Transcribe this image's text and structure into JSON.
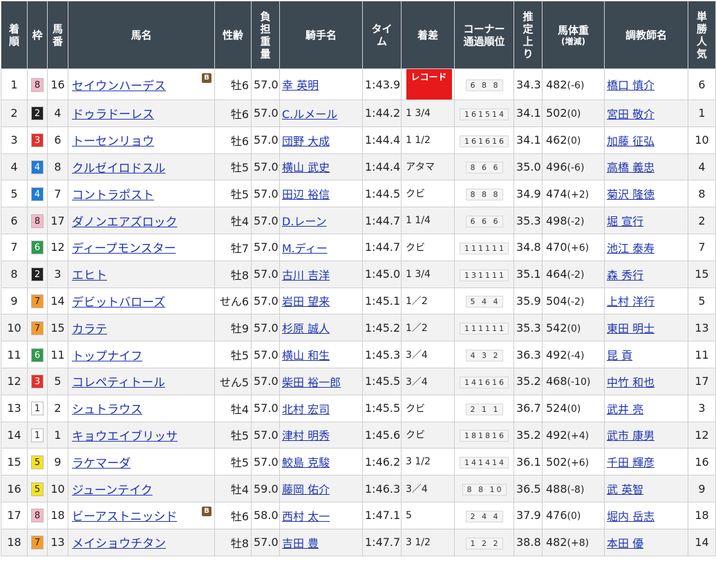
{
  "header": {
    "rank": [
      "着",
      "順"
    ],
    "waku": [
      "枠"
    ],
    "num": [
      "馬",
      "番"
    ],
    "horse": "馬名",
    "sexage": "性齢",
    "load": [
      "負",
      "担",
      "重",
      "量"
    ],
    "jockey": "騎手名",
    "time": [
      "タイ",
      "ム"
    ],
    "margin": "着差",
    "corner": [
      "コーナー",
      "通過順位"
    ],
    "last": [
      "推",
      "定",
      "上",
      "り"
    ],
    "weight_main": "馬体重",
    "weight_sub": "(増減)",
    "trainer": "調教師名",
    "pop": [
      "単",
      "勝",
      "人",
      "気"
    ]
  },
  "waku_colors": {
    "1": {
      "bg": "#ffffff",
      "fg": "#222222"
    },
    "2": {
      "bg": "#222222",
      "fg": "#ffffff"
    },
    "3": {
      "bg": "#e3312d",
      "fg": "#ffffff"
    },
    "4": {
      "bg": "#1f7bd6",
      "fg": "#ffffff"
    },
    "5": {
      "bg": "#f6e31b",
      "fg": "#222222"
    },
    "6": {
      "bg": "#2f9a4f",
      "fg": "#ffffff"
    },
    "7": {
      "bg": "#f59a2c",
      "fg": "#222222"
    },
    "8": {
      "bg": "#f6b8c8",
      "fg": "#222222"
    }
  },
  "rows": [
    {
      "rank": "1",
      "waku": "8",
      "num": "16",
      "horse": "セイウンハーデス",
      "blinker": "B",
      "sexage": "牡6",
      "load": "57.0",
      "jockey": "幸 英明",
      "time": "1:43.9",
      "margin": "",
      "record": "レコード",
      "corner": "6 8 8",
      "last": "34.3",
      "weight": "482",
      "diff": "(-6)",
      "trainer": "橋口 慎介",
      "pop": "6"
    },
    {
      "rank": "2",
      "waku": "2",
      "num": "4",
      "horse": "ドゥラドーレス",
      "blinker": "",
      "sexage": "牡6",
      "load": "57.0",
      "jockey": "C.ルメール",
      "time": "1:44.2",
      "margin": "1 3/4",
      "record": "",
      "corner": "161514",
      "last": "34.1",
      "weight": "502",
      "diff": "(0)",
      "trainer": "宮田 敬介",
      "pop": "1"
    },
    {
      "rank": "3",
      "waku": "3",
      "num": "6",
      "horse": "トーセンリョウ",
      "blinker": "",
      "sexage": "牡6",
      "load": "57.0",
      "jockey": "団野 大成",
      "time": "1:44.4",
      "margin": "1 1/2",
      "record": "",
      "corner": "161616",
      "last": "34.1",
      "weight": "462",
      "diff": "(0)",
      "trainer": "加藤 征弘",
      "pop": "10"
    },
    {
      "rank": "4",
      "waku": "4",
      "num": "8",
      "horse": "クルゼイロドスル",
      "blinker": "",
      "sexage": "牡5",
      "load": "57.0",
      "jockey": "横山 武史",
      "time": "1:44.4",
      "margin": "アタマ",
      "record": "",
      "corner": "8 6 6",
      "last": "35.0",
      "weight": "496",
      "diff": "(-6)",
      "trainer": "高橋 義忠",
      "pop": "4"
    },
    {
      "rank": "5",
      "waku": "4",
      "num": "7",
      "horse": "コントラポスト",
      "blinker": "",
      "sexage": "牡5",
      "load": "57.0",
      "jockey": "田辺 裕信",
      "time": "1:44.5",
      "margin": "クビ",
      "record": "",
      "corner": "8 8 8",
      "last": "34.9",
      "weight": "474",
      "diff": "(+2)",
      "trainer": "菊沢 隆徳",
      "pop": "8"
    },
    {
      "rank": "6",
      "waku": "8",
      "num": "17",
      "horse": "ダノンエアズロック",
      "blinker": "",
      "sexage": "牡4",
      "load": "57.0",
      "jockey": "D.レーン",
      "time": "1:44.7",
      "margin": "1 1/4",
      "record": "",
      "corner": "6 6 6",
      "last": "35.3",
      "weight": "498",
      "diff": "(-2)",
      "trainer": "堀 宣行",
      "pop": "2"
    },
    {
      "rank": "7",
      "waku": "6",
      "num": "12",
      "horse": "ディープモンスター",
      "blinker": "",
      "sexage": "牡7",
      "load": "57.0",
      "jockey": "M.ディー",
      "time": "1:44.7",
      "margin": "クビ",
      "record": "",
      "corner": "111111",
      "last": "34.8",
      "weight": "470",
      "diff": "(+6)",
      "trainer": "池江 泰寿",
      "pop": "7"
    },
    {
      "rank": "8",
      "waku": "2",
      "num": "3",
      "horse": "エヒト",
      "blinker": "",
      "sexage": "牡8",
      "load": "57.0",
      "jockey": "古川 吉洋",
      "time": "1:45.0",
      "margin": "1 3/4",
      "record": "",
      "corner": "131111",
      "last": "35.1",
      "weight": "464",
      "diff": "(-2)",
      "trainer": "森 秀行",
      "pop": "15"
    },
    {
      "rank": "9",
      "waku": "7",
      "num": "14",
      "horse": "デビットバローズ",
      "blinker": "",
      "sexage": "せん6",
      "load": "57.0",
      "jockey": "岩田 望来",
      "time": "1:45.1",
      "margin": "1／2",
      "record": "",
      "corner": "5 4 4",
      "last": "35.9",
      "weight": "504",
      "diff": "(-2)",
      "trainer": "上村 洋行",
      "pop": "5"
    },
    {
      "rank": "10",
      "waku": "7",
      "num": "15",
      "horse": "カラテ",
      "blinker": "",
      "sexage": "牡9",
      "load": "57.0",
      "jockey": "杉原 誠人",
      "time": "1:45.2",
      "margin": "1／2",
      "record": "",
      "corner": "111111",
      "last": "35.3",
      "weight": "542",
      "diff": "(0)",
      "trainer": "東田 明士",
      "pop": "13"
    },
    {
      "rank": "11",
      "waku": "6",
      "num": "11",
      "horse": "トップナイフ",
      "blinker": "",
      "sexage": "牡5",
      "load": "57.0",
      "jockey": "横山 和生",
      "time": "1:45.3",
      "margin": "3／4",
      "record": "",
      "corner": "4 3 2",
      "last": "36.3",
      "weight": "492",
      "diff": "(-4)",
      "trainer": "昆 貢",
      "pop": "11"
    },
    {
      "rank": "12",
      "waku": "3",
      "num": "5",
      "horse": "コレペティトール",
      "blinker": "",
      "sexage": "せん5",
      "load": "57.0",
      "jockey": "柴田 裕一郎",
      "time": "1:45.5",
      "margin": "3／4",
      "record": "",
      "corner": "141616",
      "last": "35.2",
      "weight": "468",
      "diff": "(-10)",
      "trainer": "中竹 和也",
      "pop": "17"
    },
    {
      "rank": "13",
      "waku": "1",
      "num": "2",
      "horse": "シュトラウス",
      "blinker": "",
      "sexage": "牡4",
      "load": "57.0",
      "jockey": "北村 宏司",
      "time": "1:45.5",
      "margin": "クビ",
      "record": "",
      "corner": "2 1 1",
      "last": "36.7",
      "weight": "524",
      "diff": "(0)",
      "trainer": "武井 亮",
      "pop": "3"
    },
    {
      "rank": "14",
      "waku": "1",
      "num": "1",
      "horse": "キョウエイブリッサ",
      "blinker": "",
      "sexage": "牡5",
      "load": "57.0",
      "jockey": "津村 明秀",
      "time": "1:45.6",
      "margin": "クビ",
      "record": "",
      "corner": "181816",
      "last": "35.2",
      "weight": "492",
      "diff": "(+4)",
      "trainer": "武市 康男",
      "pop": "12"
    },
    {
      "rank": "15",
      "waku": "5",
      "num": "9",
      "horse": "ラケマーダ",
      "blinker": "",
      "sexage": "牡5",
      "load": "57.0",
      "jockey": "鮫島 克駿",
      "time": "1:46.2",
      "margin": "3 1/2",
      "record": "",
      "corner": "141414",
      "last": "36.1",
      "weight": "502",
      "diff": "(+6)",
      "trainer": "千田 輝彦",
      "pop": "16"
    },
    {
      "rank": "16",
      "waku": "5",
      "num": "10",
      "horse": "ジューンテイク",
      "blinker": "",
      "sexage": "牡4",
      "load": "59.0",
      "jockey": "藤岡 佑介",
      "time": "1:46.3",
      "margin": "3／4",
      "record": "",
      "corner": "8 8 10",
      "last": "36.5",
      "weight": "488",
      "diff": "(-8)",
      "trainer": "武 英智",
      "pop": "9"
    },
    {
      "rank": "17",
      "waku": "8",
      "num": "18",
      "horse": "ビーアストニッシド",
      "blinker": "B",
      "sexage": "牡6",
      "load": "58.0",
      "jockey": "西村 太一",
      "time": "1:47.1",
      "margin": "5",
      "record": "",
      "corner": "2 4 4",
      "last": "37.9",
      "weight": "476",
      "diff": "(0)",
      "trainer": "堀内 岳志",
      "pop": "18"
    },
    {
      "rank": "18",
      "waku": "7",
      "num": "13",
      "horse": "メイショウチタン",
      "blinker": "",
      "sexage": "牡8",
      "load": "57.0",
      "jockey": "吉田 豊",
      "time": "1:47.7",
      "margin": "3 1/2",
      "record": "",
      "corner": "1 2 2",
      "last": "38.8",
      "weight": "482",
      "diff": "(+8)",
      "trainer": "本田 優",
      "pop": "14"
    }
  ]
}
